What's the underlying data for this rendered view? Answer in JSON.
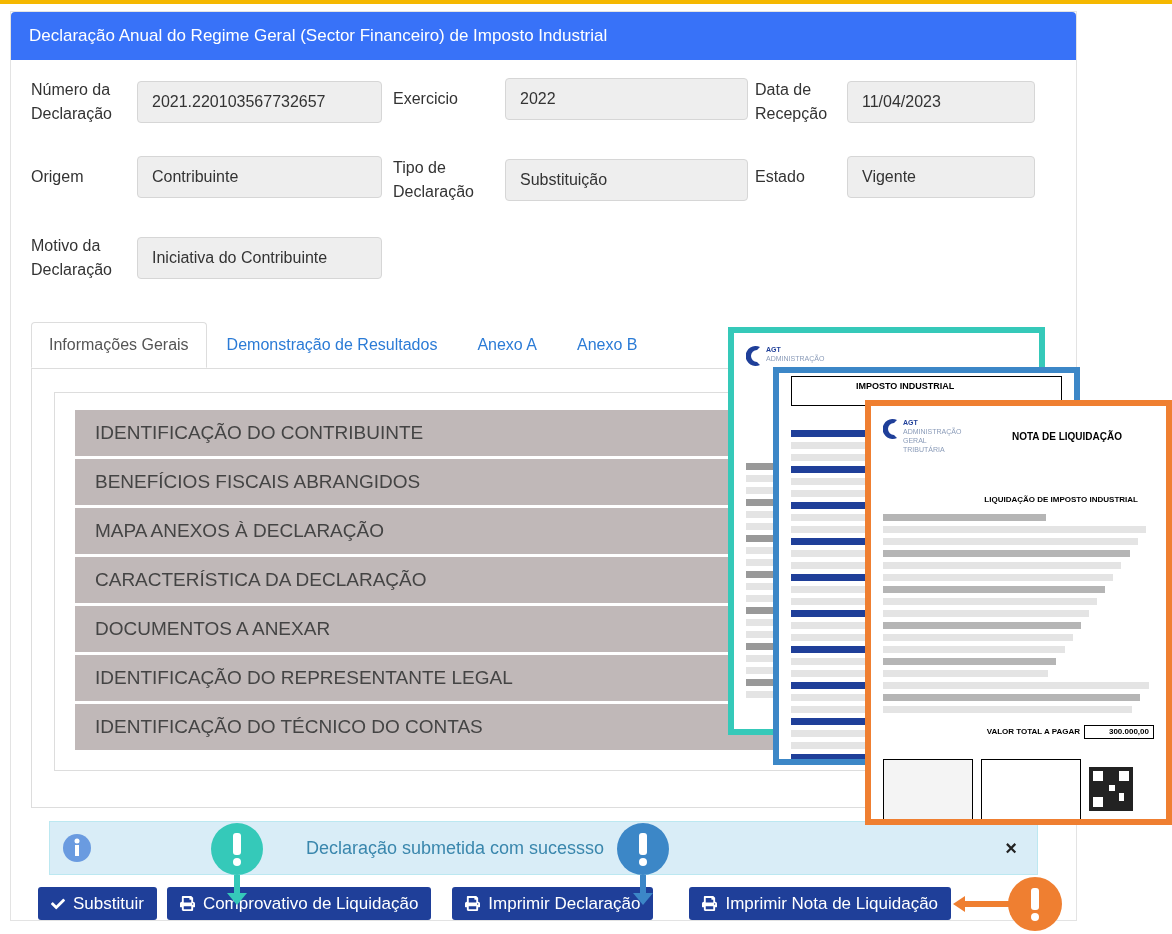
{
  "panel": {
    "title": "Declaração Anual do Regime Geral (Sector Financeiro) de Imposto Industrial"
  },
  "fields": [
    {
      "label": "Número da Declaração",
      "value": "2021.220103567732657"
    },
    {
      "label": "Exercicio",
      "value": "2022"
    },
    {
      "label": "Data de Recepção",
      "value": "11/04/2023"
    },
    {
      "label": "Origem",
      "value": "Contribuinte"
    },
    {
      "label": "Tipo de Declaração",
      "value": "Substituição"
    },
    {
      "label": "Estado",
      "value": "Vigente"
    },
    {
      "label": "Motivo da Declaração",
      "value": "Iniciativa do Contribuinte"
    }
  ],
  "tabs": [
    {
      "label": "Informações Gerais",
      "selected": true
    },
    {
      "label": "Demonstração de Resultados",
      "selected": false
    },
    {
      "label": "Anexo A",
      "selected": false
    },
    {
      "label": "Anexo B",
      "selected": false
    }
  ],
  "sections": [
    "IDENTIFICAÇÃO DO CONTRIBUINTE",
    "BENEFÍCIOS FISCAIS ABRANGIDOS",
    "MAPA ANEXOS À DECLARAÇÃO",
    "CARACTERÍSTICA DA DECLARAÇÃO",
    "DOCUMENTOS A ANEXAR",
    "IDENTIFICAÇÃO DO REPRESENTANTE LEGAL",
    "IDENTIFICAÇÃO DO TÉCNICO DO CONTAS"
  ],
  "documents": [
    {
      "kind": "comprovativo",
      "color": "#35c9b9",
      "logo": "AGT",
      "agency": "ADMINISTRAÇÃO"
    },
    {
      "kind": "declaracao",
      "color": "#3c87c7",
      "title": "IMPOSTO INDUSTRIAL"
    },
    {
      "kind": "nota",
      "color": "#ef7f31",
      "logo": "AGT",
      "agency": "ADMINISTRAÇÃO GERAL TRIBUTÁRIA",
      "title": "NOTA DE LIQUIDAÇÃO",
      "subtitle": "LIQUIDAÇÃO DE IMPOSTO INDUSTRIAL",
      "total_label": "VALOR TOTAL A PAGAR",
      "total": "300.000,00"
    }
  ],
  "alert": {
    "message": "Declaração submetida com sucessso",
    "close": "×"
  },
  "buttons": [
    {
      "kind": "check",
      "label": "Substituir"
    },
    {
      "kind": "print",
      "label": "Comprovativo de Liquidação",
      "color": "#35c9b9"
    },
    {
      "kind": "print",
      "label": "Imprimir Declaração",
      "color": "#3c87c7"
    },
    {
      "kind": "print",
      "label": "Imprimir Nota de Liquidação",
      "color": "#ef7f31"
    }
  ]
}
